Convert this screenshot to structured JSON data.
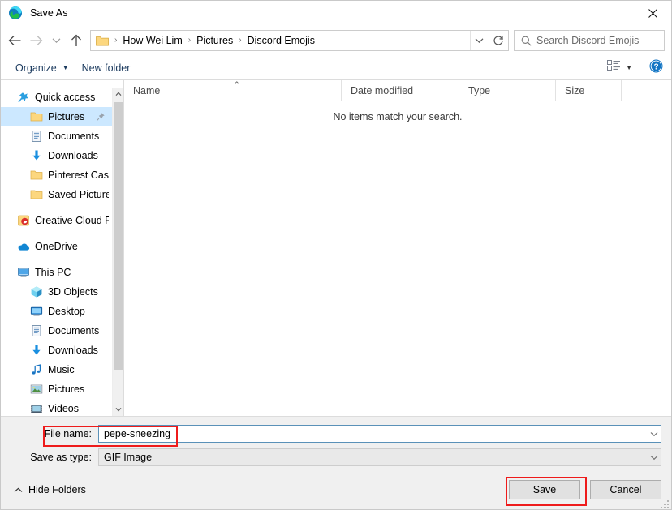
{
  "window": {
    "title": "Save As",
    "app_icon": "edge-logo-icon",
    "close_label": "✕"
  },
  "nav": {
    "back_icon": "arrow-left-icon",
    "forward_icon": "arrow-right-icon",
    "recent_icon": "chevron-down-icon",
    "up_icon": "arrow-up-icon",
    "refresh_icon": "refresh-icon",
    "address_dropdown_icon": "chevron-down-icon",
    "breadcrumbs": [
      "How Wei Lim",
      "Pictures",
      "Discord Emojis"
    ],
    "breadcrumb_separator": "›",
    "search": {
      "placeholder": "Search Discord Emojis",
      "value": "",
      "icon": "search-icon"
    }
  },
  "command_bar": {
    "organize_label": "Organize",
    "organize_caret": "▼",
    "new_folder_label": "New folder",
    "view_icon": "view-list-icon",
    "view_caret": "▼",
    "help_icon": "help-icon"
  },
  "nav_pane": {
    "items": [
      {
        "label": "Quick access",
        "icon": "pin-star-icon",
        "level": 0,
        "selected": false,
        "pinned": false,
        "gap_before": false
      },
      {
        "label": "Pictures",
        "icon": "folder-icon",
        "level": 1,
        "selected": true,
        "pinned": true,
        "gap_before": false
      },
      {
        "label": "Documents",
        "icon": "documents-icon",
        "level": 1,
        "selected": false,
        "pinned": false,
        "gap_before": false
      },
      {
        "label": "Downloads",
        "icon": "downloads-icon",
        "level": 1,
        "selected": false,
        "pinned": false,
        "gap_before": false
      },
      {
        "label": "Pinterest Case St",
        "icon": "folder-icon",
        "level": 1,
        "selected": false,
        "pinned": false,
        "gap_before": false
      },
      {
        "label": "Saved Pictures",
        "icon": "folder-icon",
        "level": 1,
        "selected": false,
        "pinned": false,
        "gap_before": false
      },
      {
        "label": "Creative Cloud Fil",
        "icon": "creative-cloud-icon",
        "level": 0,
        "selected": false,
        "pinned": false,
        "gap_before": true
      },
      {
        "label": "OneDrive",
        "icon": "onedrive-icon",
        "level": 0,
        "selected": false,
        "pinned": false,
        "gap_before": true
      },
      {
        "label": "This PC",
        "icon": "this-pc-icon",
        "level": 0,
        "selected": false,
        "pinned": false,
        "gap_before": true
      },
      {
        "label": "3D Objects",
        "icon": "3d-objects-icon",
        "level": 1,
        "selected": false,
        "pinned": false,
        "gap_before": false
      },
      {
        "label": "Desktop",
        "icon": "desktop-icon",
        "level": 1,
        "selected": false,
        "pinned": false,
        "gap_before": false
      },
      {
        "label": "Documents",
        "icon": "documents-icon",
        "level": 1,
        "selected": false,
        "pinned": false,
        "gap_before": false
      },
      {
        "label": "Downloads",
        "icon": "downloads-icon",
        "level": 1,
        "selected": false,
        "pinned": false,
        "gap_before": false
      },
      {
        "label": "Music",
        "icon": "music-icon",
        "level": 1,
        "selected": false,
        "pinned": false,
        "gap_before": false
      },
      {
        "label": "Pictures",
        "icon": "pictures-icon",
        "level": 1,
        "selected": false,
        "pinned": false,
        "gap_before": false
      },
      {
        "label": "Videos",
        "icon": "videos-icon",
        "level": 1,
        "selected": false,
        "pinned": false,
        "gap_before": false
      }
    ],
    "scrollbar": {
      "up_icon": "chevron-up-icon",
      "down_icon": "chevron-down-icon"
    }
  },
  "file_list": {
    "columns": [
      {
        "key": "name",
        "label": "Name"
      },
      {
        "key": "date",
        "label": "Date modified"
      },
      {
        "key": "type",
        "label": "Type"
      },
      {
        "key": "size",
        "label": "Size"
      }
    ],
    "sort_caret": "⌃",
    "rows": [],
    "empty_message": "No items match your search."
  },
  "form": {
    "filename_label": "File name:",
    "filename_value": "pepe-sneezing",
    "filename_placeholder": "",
    "savetype_label": "Save as type:",
    "savetype_value": "GIF Image",
    "dropdown_icon": "chevron-down-icon",
    "highlight_color": "#ee1b1b"
  },
  "footer": {
    "hide_folders_label": "Hide Folders",
    "hide_folders_icon": "chevron-up-icon",
    "save_label": "Save",
    "cancel_label": "Cancel",
    "resize_grip_icon": "resize-grip-icon"
  }
}
